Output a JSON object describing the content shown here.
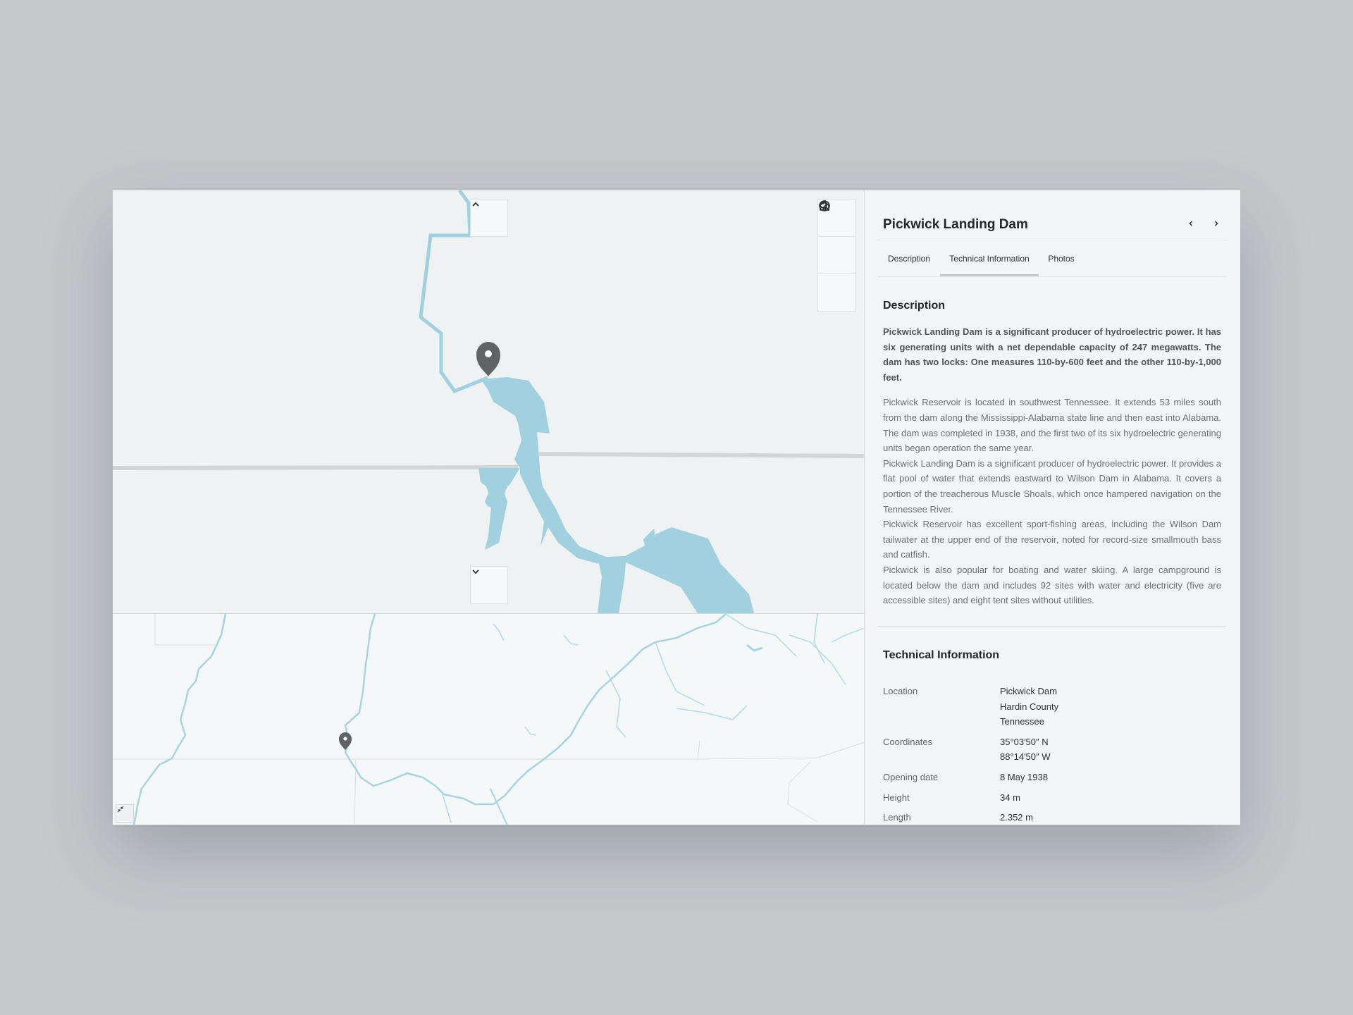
{
  "colors": {
    "background": "#c5c9cc",
    "water": "#9fd0e0",
    "marker": "#5f6366",
    "panel": "#f3f6f7"
  },
  "map": {
    "controls": {
      "up": "chevron-up-icon",
      "down": "chevron-down-icon",
      "home": "home-icon",
      "search": "search-icon",
      "help": "help-icon",
      "minimap_toggle": "collapse-icon"
    }
  },
  "panel": {
    "title": "Pickwick Landing Dam",
    "prev_icon": "chevron-left-icon",
    "next_icon": "chevron-right-icon",
    "tabs": [
      {
        "label": "Description"
      },
      {
        "label": "Technical Information",
        "active": true
      },
      {
        "label": "Photos"
      }
    ],
    "description": {
      "heading": "Description",
      "lead": "Pickwick Landing Dam is a significant producer of hydroelectric power. It has six generating units with a net dependable capacity of 247 megawatts. The dam has two locks: One measures 110-by-600 feet and the other 110-by-1,000 feet.",
      "paragraphs": [
        "Pickwick Reservoir is located in southwest Tennessee. It extends 53 miles south from the dam along the Mississippi-Alabama state line and then east into Alabama. The dam was completed in 1938, and the first two of its six hydroelectric generating units began operation the same year.",
        "Pickwick Landing Dam is a significant producer of hydroelectric power. It provides a flat pool of water that extends eastward to Wilson Dam in Alabama. It covers a portion of the treacherous Muscle Shoals, which once hampered navigation on the Tennessee River.",
        "Pickwick Reservoir has excellent sport-fishing areas, including the Wilson Dam tailwater at the upper end of the reservoir, noted for record-size smallmouth bass and catfish.",
        "Pickwick is also popular for boating and water skiing. A large campground is located below the dam and includes 92 sites with water and electricity (five are accessible sites) and eight tent sites without utilities."
      ]
    },
    "technical": {
      "heading": "Technical Information",
      "rows": [
        {
          "label": "Location",
          "lines": [
            "Pickwick Dam",
            "Hardin County",
            "Tennessee"
          ]
        },
        {
          "label": "Coordinates",
          "lines": [
            "35°03′50″ N",
            "88°14′50″ W"
          ]
        },
        {
          "label": "Opening date",
          "lines": [
            "8 May 1938"
          ]
        },
        {
          "label": "Height",
          "lines": [
            "34 m"
          ]
        },
        {
          "label": "Length",
          "lines": [
            "2.352 m"
          ]
        }
      ]
    }
  }
}
